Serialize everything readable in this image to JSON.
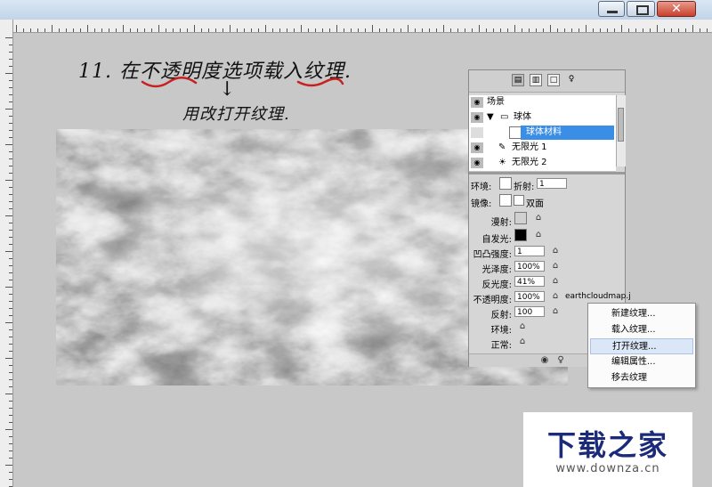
{
  "window": {
    "close_label": "✕"
  },
  "annotation": {
    "step_title": "11. 在不透明度选项载入纹理.",
    "arrow": "↓",
    "step_sub": "用改打开纹理."
  },
  "panel": {
    "tree": [
      {
        "label": "场景"
      },
      {
        "label": "球体"
      },
      {
        "label": "球体材料"
      },
      {
        "label": "无限光 1"
      },
      {
        "label": "无限光 2"
      }
    ],
    "props": {
      "ambient_label": "环境:",
      "refraction_label": "折射:",
      "refraction_value": "1",
      "specular_label": "镜像:",
      "double_sided_label": "双面",
      "diffuse_label": "漫射:",
      "self_illum_label": "自发光:",
      "bump_label": "凹凸强度:",
      "bump_value": "1",
      "gloss_label": "光泽度:",
      "gloss_value": "100%",
      "shine_label": "反光度:",
      "shine_value": "41%",
      "opacity_label": "不透明度:",
      "opacity_value": "100%",
      "opacity_texture": "earthcloudmap.j",
      "reflect_label": "反射:",
      "reflect_value": "100",
      "env_label": "环境:",
      "normal_label": "正常:"
    }
  },
  "context_menu": {
    "items": [
      "新建纹理...",
      "载入纹理...",
      "打开纹理...",
      "编辑属性...",
      "移去纹理"
    ]
  },
  "watermark": {
    "title": "下载之家",
    "url": "www.downza.cn"
  },
  "colors": {
    "selection": "#3b8ee6",
    "annotation_red": "#c82020",
    "watermark_blue": "#1c2a7a"
  }
}
